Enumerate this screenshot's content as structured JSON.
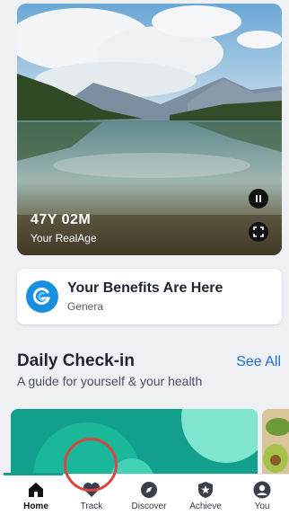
{
  "hero": {
    "realage_value": "47Y 02M",
    "realage_label": "Your RealAge"
  },
  "benefits": {
    "title": "Your Benefits Are Here",
    "subtitle": "Genera"
  },
  "daily_checkin": {
    "title": "Daily Check-in",
    "see_all": "See All",
    "subtitle": "A guide for yourself & your health"
  },
  "tabs": [
    {
      "label": "Home",
      "icon": "home-icon",
      "active": true
    },
    {
      "label": "Track",
      "icon": "heart-icon",
      "active": false
    },
    {
      "label": "Discover",
      "icon": "compass-icon",
      "active": false
    },
    {
      "label": "Achieve",
      "icon": "shield-star-icon",
      "active": false
    },
    {
      "label": "You",
      "icon": "person-icon",
      "active": false
    }
  ],
  "colors": {
    "accent_teal": "#12a08c",
    "link_blue": "#1a6fd8",
    "highlight_red": "#d8473f"
  }
}
